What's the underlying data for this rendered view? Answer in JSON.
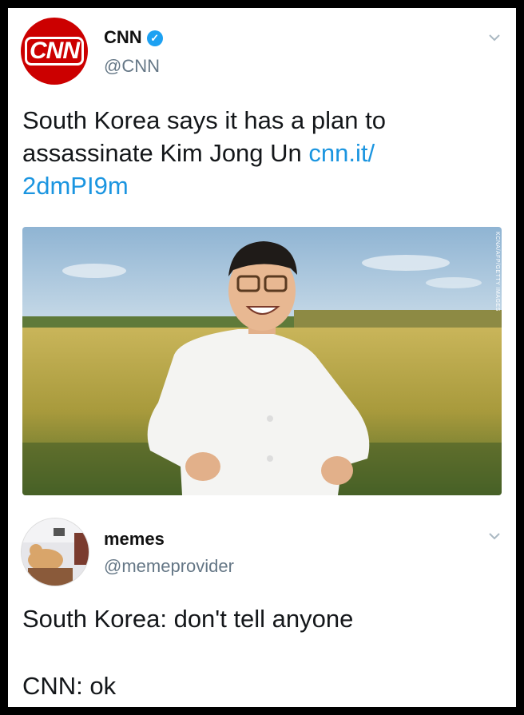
{
  "tweets": [
    {
      "name": "CNN",
      "handle": "@CNN",
      "avatar_text": "CNN",
      "verified": true,
      "text": "South Korea says it has a plan to assassinate Kim Jong Un ",
      "link": "cnn.it/\n2dmPI9m",
      "photo_credit": "KCNA/AFP/GETTY IMAGES"
    },
    {
      "name": "memes",
      "handle": "@memeprovider",
      "line1": "South Korea: don't tell anyone",
      "line2": "CNN: ok"
    }
  ],
  "colors": {
    "cnn_red": "#cc0000",
    "link_blue": "#1b95e0",
    "verified_blue": "#1da1f2",
    "handle_gray": "#657786"
  }
}
